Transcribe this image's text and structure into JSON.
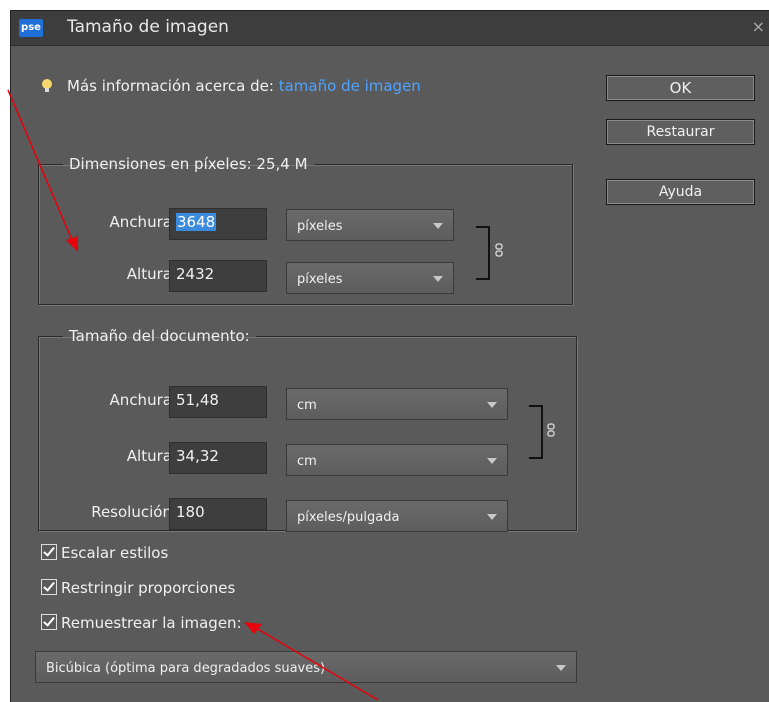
{
  "window": {
    "app_logo": "pse",
    "title": "Tamaño de imagen",
    "close_glyph": "×"
  },
  "info": {
    "prefix": "Más información acerca de:",
    "link": "tamaño de imagen"
  },
  "buttons": {
    "ok": "OK",
    "restaurar": "Restaurar",
    "ayuda": "Ayuda"
  },
  "pixel_dimensions": {
    "legend": "Dimensiones en píxeles: 25,4 M",
    "width_label": "Anchura:",
    "width_value": "3648",
    "width_unit": "píxeles",
    "height_label": "Altura:",
    "height_value": "2432",
    "height_unit": "píxeles"
  },
  "document_size": {
    "legend": "Tamaño del documento:",
    "width_label": "Anchura:",
    "width_value": "51,48",
    "width_unit": "cm",
    "height_label": "Altura:",
    "height_value": "34,32",
    "height_unit": "cm",
    "resolution_label": "Resolución:",
    "resolution_value": "180",
    "resolution_unit": "píxeles/pulgada"
  },
  "checkboxes": [
    {
      "label": "Escalar estilos",
      "checked": true
    },
    {
      "label": "Restringir proporciones",
      "checked": true
    },
    {
      "label": "Remuestrear la imagen:",
      "checked": true
    }
  ],
  "resample_method": "Bicúbica (óptima para degradados suaves)",
  "colors": {
    "dialog_bg": "#5a5a5a",
    "titlebar_bg": "#3d3d3d",
    "link": "#4fa3ff",
    "selection": "#3a8bde",
    "annotation_arrow": "#e8000b"
  }
}
